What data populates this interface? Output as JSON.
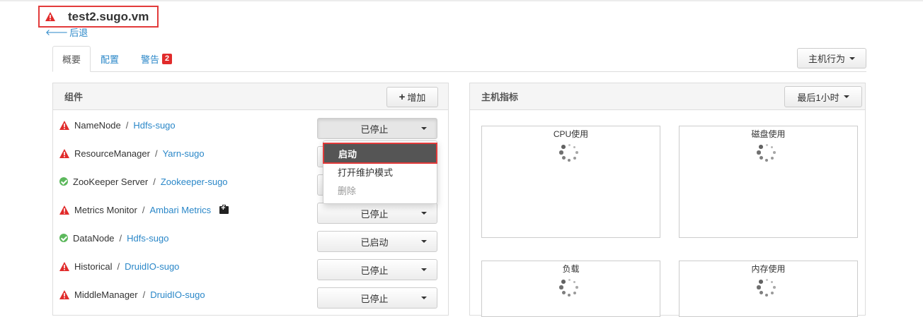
{
  "host": {
    "name": "test2.sugo.vm",
    "back_label": "后退"
  },
  "tabs": [
    {
      "label": "概要"
    },
    {
      "label": "配置"
    },
    {
      "label": "警告",
      "badge": "2"
    }
  ],
  "host_actions_label": "主机行为",
  "components_panel": {
    "title": "组件",
    "add_label": "增加"
  },
  "components": [
    {
      "name": "NameNode",
      "service": "Hdfs-sugo",
      "status": "已停止",
      "health": "warning"
    },
    {
      "name": "ResourceManager",
      "service": "Yarn-sugo",
      "status": "",
      "health": "warning"
    },
    {
      "name": "ZooKeeper Server",
      "service": "Zookeeper-sugo",
      "status": "",
      "health": "ok"
    },
    {
      "name": "Metrics Monitor",
      "service": "Ambari Metrics",
      "status": "已停止",
      "health": "warning",
      "maintenance": true
    },
    {
      "name": "DataNode",
      "service": "Hdfs-sugo",
      "status": "已启动",
      "health": "ok"
    },
    {
      "name": "Historical",
      "service": "DruidIO-sugo",
      "status": "已停止",
      "health": "warning"
    },
    {
      "name": "MiddleManager",
      "service": "DruidIO-sugo",
      "status": "已停止",
      "health": "warning"
    }
  ],
  "menu": {
    "items": [
      "启动",
      "打开维护模式",
      "删除"
    ]
  },
  "metrics_panel": {
    "title": "主机指标",
    "range_label": "最后1小时",
    "charts": [
      "CPU使用",
      "磁盘使用",
      "负载",
      "内存使用"
    ]
  },
  "colors": {
    "link": "#2a87c8",
    "alert": "#e12b2b",
    "ok": "#5cb85c",
    "highlight_border": "#e23b3b"
  }
}
